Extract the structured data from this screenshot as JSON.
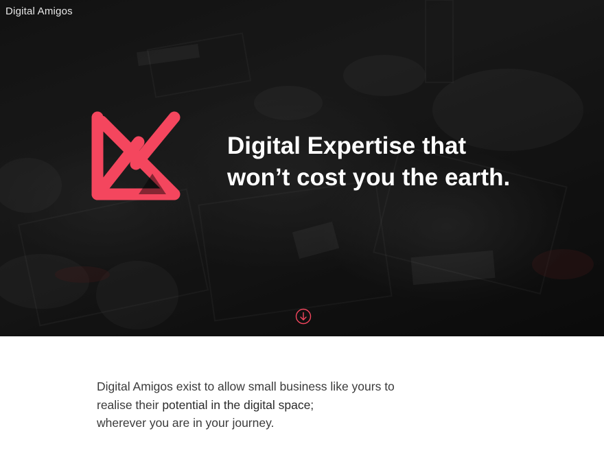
{
  "site": {
    "brand_name": "Digital Amigos"
  },
  "hero": {
    "headline_line1": "Digital Expertise that",
    "headline_line2": "won’t cost you the earth.",
    "logo_icon": "digital-amigos-logo-icon",
    "scroll_icon": "arrow-down-circle-icon"
  },
  "intro": {
    "line1": "Digital Amigos exist to allow small business like yours to",
    "line2_start": "realise their ",
    "line2_emphasis": "potential in the digital space;",
    "line3": "wherever you are in your journey."
  },
  "colors": {
    "accent": "#f4465e",
    "hero_text": "#ffffff",
    "body_text": "#3a3a3a",
    "background": "#ffffff"
  }
}
